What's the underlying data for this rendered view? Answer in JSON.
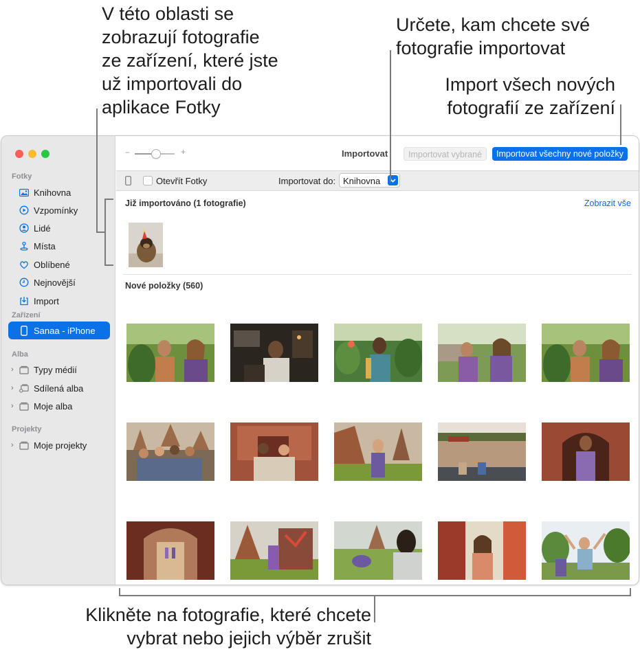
{
  "callouts": {
    "imported_area": [
      "V této oblasti se",
      "zobrazují fotografie",
      "ze zařízení, které jste",
      "už importovali do",
      "aplikace Fotky"
    ],
    "destination": [
      "Určete, kam chcete své",
      "fotografie importovat"
    ],
    "import_all": [
      "Import všech nových",
      "fotografií ze zařízení"
    ],
    "select_photos": [
      "Klikněte na fotografie, které chcete",
      "vybrat nebo jejich výběr zrušit"
    ]
  },
  "sidebar": {
    "sections": {
      "fotky": "Fotky",
      "zarizeni": "Zařízení",
      "alba": "Alba",
      "projekty": "Projekty"
    },
    "items": [
      {
        "label": "Knihovna",
        "icon": "photo-library-icon"
      },
      {
        "label": "Vzpomínky",
        "icon": "memories-icon"
      },
      {
        "label": "Lidé",
        "icon": "people-icon"
      },
      {
        "label": "Místa",
        "icon": "places-pin-icon"
      },
      {
        "label": "Oblíbené",
        "icon": "heart-icon"
      },
      {
        "label": "Nejnovější",
        "icon": "clock-icon"
      },
      {
        "label": "Import",
        "icon": "import-icon"
      }
    ],
    "device": {
      "label": "Sanaa - iPhone",
      "icon": "iphone-icon"
    },
    "albums": [
      {
        "label": "Typy médií",
        "icon": "folder-icon"
      },
      {
        "label": "Sdílená alba",
        "icon": "shared-album-icon"
      },
      {
        "label": "Moje alba",
        "icon": "folder-icon"
      }
    ],
    "projects": [
      {
        "label": "Moje projekty",
        "icon": "folder-icon"
      }
    ]
  },
  "toolbar": {
    "zoom_minus": "−",
    "zoom_plus": "+",
    "zoom_level": 0.55,
    "title": "Importovat",
    "import_selected": "Importovat vybrané",
    "import_all": "Importovat všechny nové položky"
  },
  "importbar": {
    "open_photos_label": "Otevřít Fotky",
    "open_photos_checked": false,
    "import_to_label": "Importovat do:",
    "import_to_value": "Knihovna"
  },
  "content": {
    "already_imported_title": "Již importováno (1 fotografie)",
    "show_all": "Zobrazit vše",
    "new_items_title": "Nové položky (560)"
  },
  "colors": {
    "accent": "#0a72e6",
    "sidebar_bg": "#e8e8e8",
    "close": "#fe5f57",
    "minimize": "#febc2e",
    "zoom": "#28c840"
  }
}
